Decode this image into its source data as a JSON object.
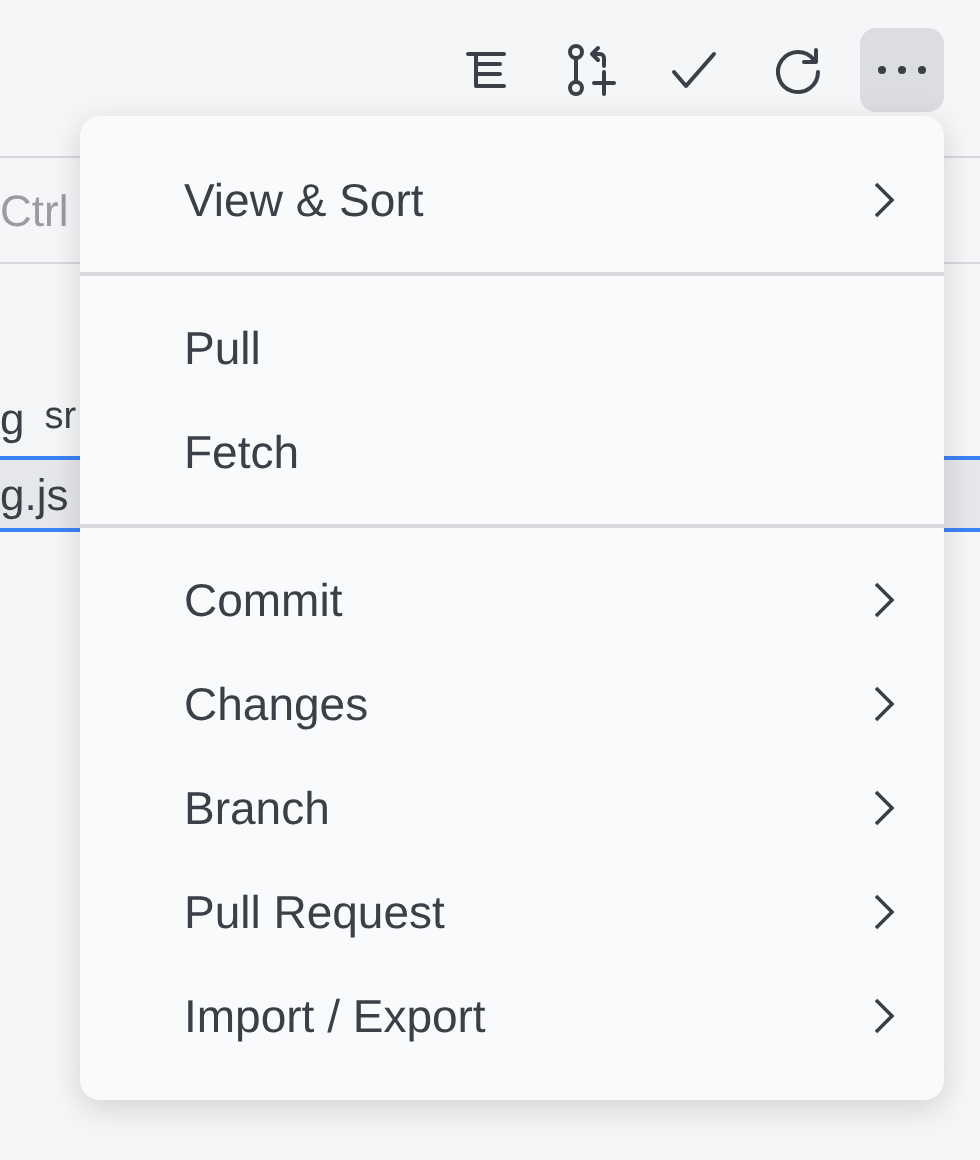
{
  "toolbar": {
    "buttons": [
      {
        "kind": "list",
        "selected": false
      },
      {
        "kind": "branch",
        "selected": false
      },
      {
        "kind": "check",
        "selected": false
      },
      {
        "kind": "refresh",
        "selected": false
      },
      {
        "kind": "more",
        "selected": true
      }
    ]
  },
  "background": {
    "search": {
      "placeholder": "Ctrl"
    },
    "rows": [
      {
        "texts": [
          "g",
          "sr"
        ],
        "selected": false
      },
      {
        "texts": [
          "g.js"
        ],
        "selected": true
      }
    ]
  },
  "menu": {
    "groups": [
      {
        "items": [
          {
            "label": "View & Sort",
            "submenu": true
          }
        ]
      },
      {
        "items": [
          {
            "label": "Pull",
            "submenu": false
          },
          {
            "label": "Fetch",
            "submenu": false
          }
        ]
      },
      {
        "items": [
          {
            "label": "Commit",
            "submenu": true
          },
          {
            "label": "Changes",
            "submenu": true
          },
          {
            "label": "Branch",
            "submenu": true
          },
          {
            "label": "Pull Request",
            "submenu": true
          },
          {
            "label": "Import / Export",
            "submenu": true
          }
        ]
      }
    ]
  }
}
